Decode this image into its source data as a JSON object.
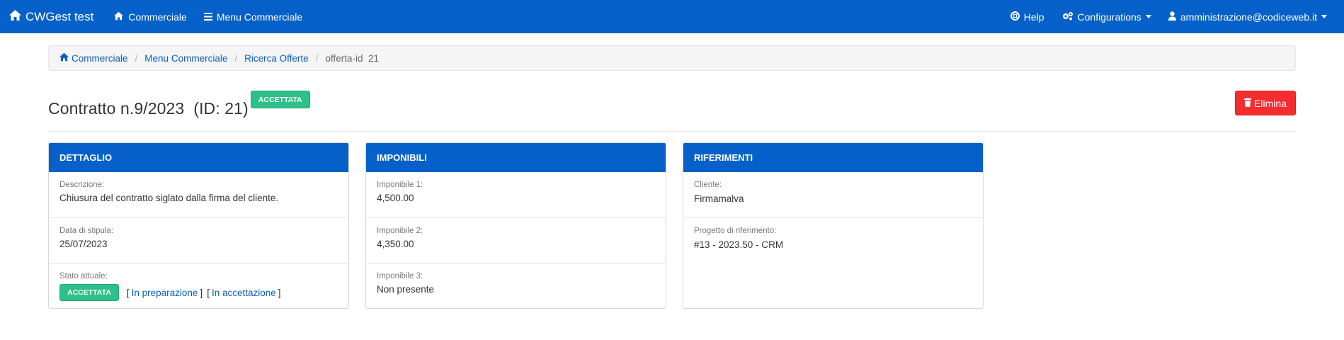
{
  "navbar": {
    "brand": "CWGest test",
    "commerciale": "Commerciale",
    "menu_commerciale": "Menu Commerciale",
    "help": "Help",
    "configurations": "Configurations",
    "user": "amministrazione@codiceweb.it"
  },
  "breadcrumb": {
    "items": [
      "Commerciale",
      "Menu Commerciale",
      "Ricerca Offerte"
    ],
    "active": "offerta-id  21"
  },
  "header": {
    "title": "Contratto n.9/2023  (ID: 21)",
    "status_badge": "ACCETTATA",
    "delete_label": "Elimina"
  },
  "panels": {
    "dettaglio": {
      "heading": "DETTAGLIO",
      "descrizione_label": "Descrizione:",
      "descrizione_value": "Chiusura del contratto siglato dalla firma del cliente.",
      "data_label": "Data di stipula:",
      "data_value": "25/07/2023",
      "stato_label": "Stato attuale:",
      "stato_badge": "ACCETTATA",
      "stato_link_1": "In preparazione",
      "stato_link_2": "In accettazione"
    },
    "imponibili": {
      "heading": "IMPONIBILI",
      "imp1_label": "Imponibile 1:",
      "imp1_value": "4,500.00",
      "imp2_label": "Imponibile 2:",
      "imp2_value": "4,350.00",
      "imp3_label": "Imponibile 3:",
      "imp3_value": "Non presente"
    },
    "riferimenti": {
      "heading": "RIFERIMENTI",
      "cliente_label": "Cliente:",
      "cliente_value": "Firmamalva",
      "progetto_label": "Progetto di riferimento:",
      "progetto_value": "#13 - 2023.50 - CRM"
    }
  },
  "colors": {
    "primary": "#0561c9",
    "success": "#2ec089",
    "danger": "#f52d30",
    "link": "#0a5fc4"
  }
}
